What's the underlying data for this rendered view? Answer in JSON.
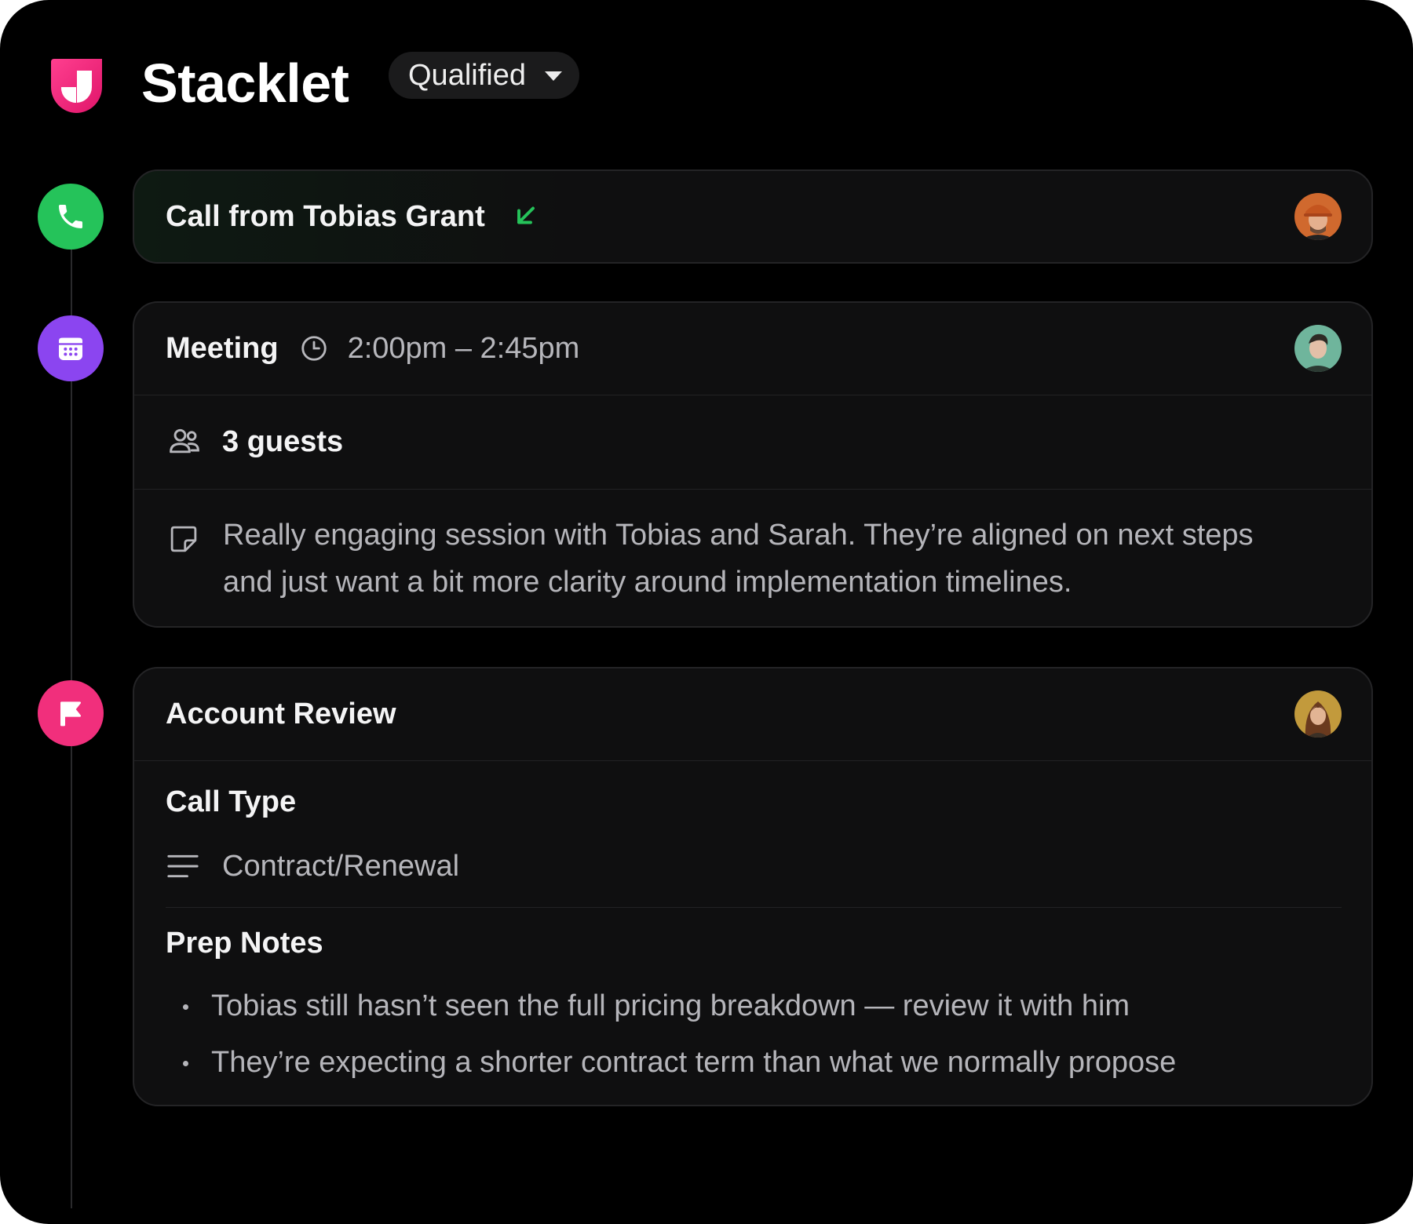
{
  "header": {
    "app_name": "Stacklet",
    "status": "Qualified",
    "logo_icon": "stacklet-logo-icon",
    "brand_color": "#f12f7c"
  },
  "timeline": {
    "call": {
      "icon": "phone-icon",
      "color": "#25c35a",
      "title": "Call from Tobias Grant",
      "direction_icon": "arrow-down-left-icon",
      "direction": "incoming",
      "avatar": "avatar-tobias"
    },
    "meeting": {
      "icon": "calendar-icon",
      "color": "#8b45f0",
      "title": "Meeting",
      "time_icon": "clock-icon",
      "time": "2:00pm – 2:45pm",
      "guests_icon": "users-icon",
      "guests": "3 guests",
      "note_icon": "sticky-note-icon",
      "note_line1": "Really engaging session with Tobias and Sarah. They’re aligned on next steps",
      "note_line2": "and just want a bit more clarity around implementation timelines.",
      "avatar": "avatar-host"
    },
    "review": {
      "icon": "flag-icon",
      "color": "#f12f7c",
      "title": "Account Review",
      "call_type_label": "Call Type",
      "call_type_icon": "text-lines-icon",
      "call_type_value": "Contract/Renewal",
      "prep_notes_label": "Prep Notes",
      "prep_notes": [
        "Tobias still hasn’t seen the full pricing breakdown — review it with him",
        "They’re expecting a shorter contract term than what we normally propose"
      ],
      "avatar": "avatar-reviewer"
    }
  }
}
